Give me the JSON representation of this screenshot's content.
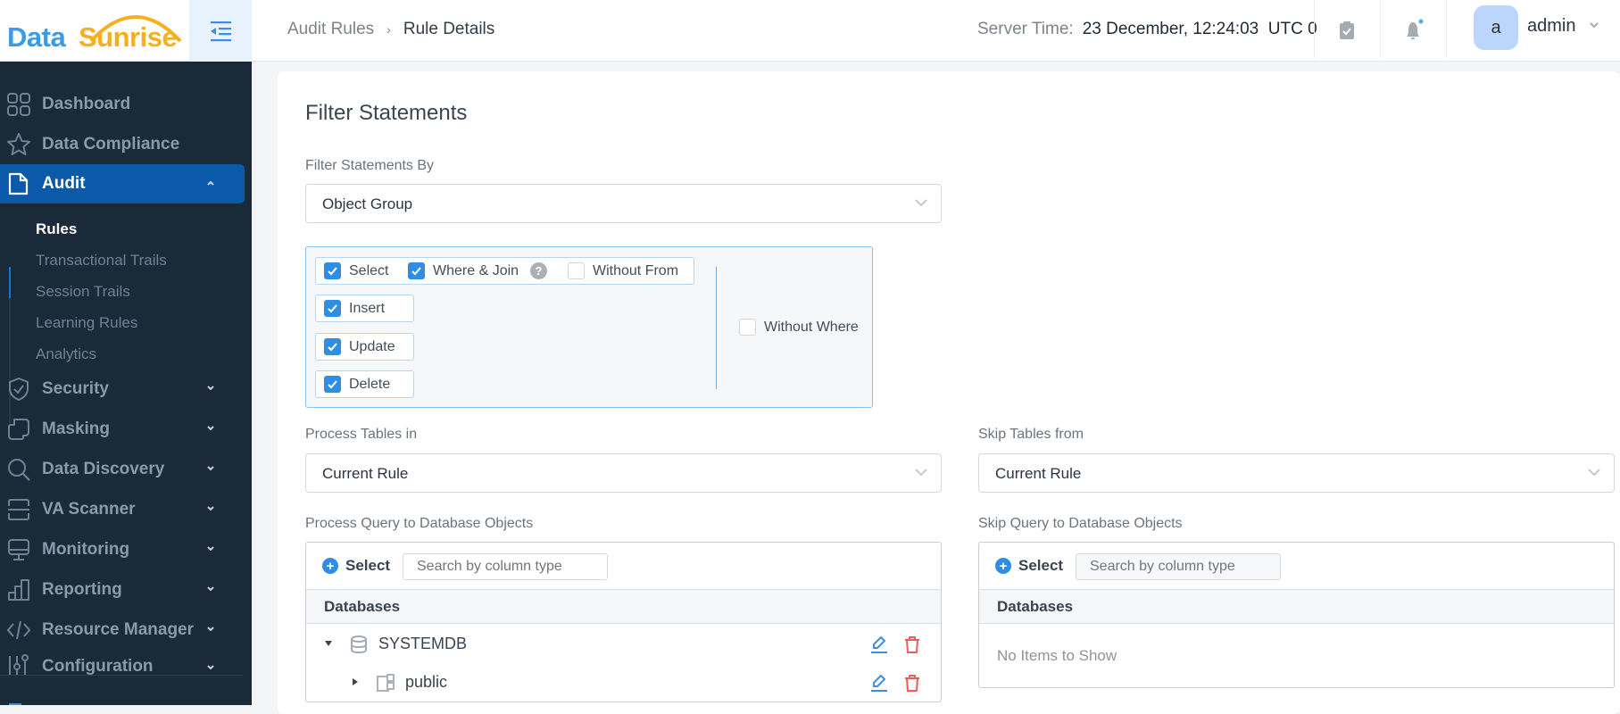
{
  "app": {
    "logo_part1": "Data",
    "logo_part2": "Sunrise",
    "brand_color": "#3a9be8",
    "accent_color": "#f6b01e"
  },
  "header": {
    "breadcrumb": [
      {
        "label": "Audit Rules"
      },
      {
        "label": "Rule Details"
      }
    ],
    "breadcrumb_separator": "›",
    "server_time_label": "Server Time:",
    "server_time_value": "23 December, 12:24:03  UTC 0",
    "icons": [
      "clipboard-check-icon",
      "bell-icon"
    ],
    "user": {
      "avatar_letter": "a",
      "name": "admin"
    }
  },
  "sidebar": {
    "items": [
      {
        "label": "Dashboard",
        "icon": "dashboard-grid-icon",
        "expandable": false
      },
      {
        "label": "Data Compliance",
        "icon": "star-icon",
        "expandable": false
      },
      {
        "label": "Audit",
        "icon": "document-icon",
        "expandable": true,
        "expanded": true,
        "active": true
      },
      {
        "label": "Security",
        "icon": "shield-check-icon",
        "expandable": true
      },
      {
        "label": "Masking",
        "icon": "masking-icon",
        "expandable": true
      },
      {
        "label": "Data Discovery",
        "icon": "search-icon",
        "expandable": true
      },
      {
        "label": "VA Scanner",
        "icon": "scanner-icon",
        "expandable": true
      },
      {
        "label": "Monitoring",
        "icon": "monitor-icon",
        "expandable": true
      },
      {
        "label": "Reporting",
        "icon": "bar-chart-icon",
        "expandable": true
      },
      {
        "label": "Resource Manager",
        "icon": "code-icon",
        "expandable": true
      },
      {
        "label": "Configuration",
        "icon": "sliders-icon",
        "expandable": true
      }
    ],
    "audit_subitems": [
      {
        "label": "Rules",
        "active": true
      },
      {
        "label": "Transactional Trails"
      },
      {
        "label": "Session Trails"
      },
      {
        "label": "Learning Rules"
      },
      {
        "label": "Analytics"
      }
    ]
  },
  "main": {
    "section_title": "Filter Statements",
    "filter_by": {
      "label": "Filter Statements By",
      "value": "Object Group"
    },
    "statements": {
      "select": {
        "label": "Select",
        "checked": true
      },
      "where_join": {
        "label": "Where & Join",
        "checked": true,
        "help": "?"
      },
      "without_from": {
        "label": "Without From",
        "checked": false
      },
      "insert": {
        "label": "Insert",
        "checked": true
      },
      "update": {
        "label": "Update",
        "checked": true
      },
      "delete": {
        "label": "Delete",
        "checked": true
      },
      "without_where": {
        "label": "Without Where",
        "checked": false
      }
    },
    "process_tables": {
      "label": "Process Tables in",
      "value": "Current Rule"
    },
    "skip_tables": {
      "label": "Skip Tables from",
      "value": "Current Rule"
    },
    "process_query": {
      "label": "Process Query to Database Objects",
      "select_label": "Select",
      "search_placeholder": "Search by column type",
      "column_header": "Databases",
      "rows": [
        {
          "name": "SYSTEMDB",
          "type": "database",
          "expanded": true,
          "level": 0
        },
        {
          "name": "public",
          "type": "schema",
          "expanded": false,
          "level": 1
        }
      ]
    },
    "skip_query": {
      "label": "Skip Query to Database Objects",
      "select_label": "Select",
      "search_placeholder": "Search by column type",
      "column_header": "Databases",
      "empty_text": "No Items to Show"
    }
  }
}
